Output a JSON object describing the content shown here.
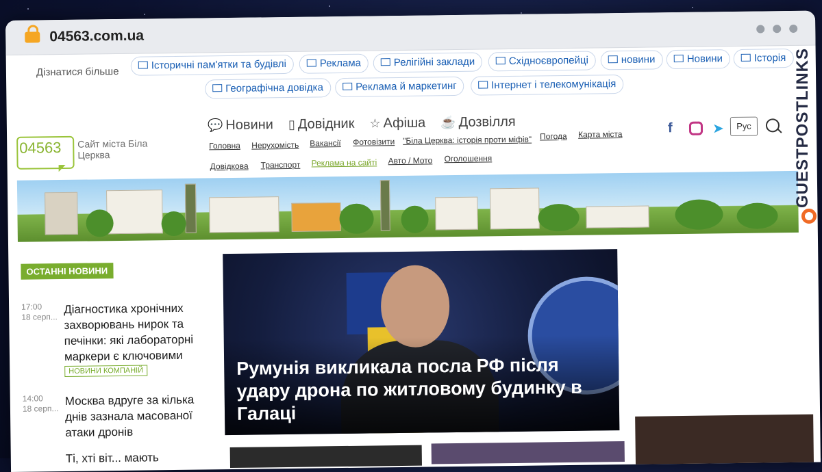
{
  "browser": {
    "url": "04563.com.ua"
  },
  "tags_bar": {
    "label": "Дізнатися більше",
    "tags": [
      "Історичні пам'ятки та будівлі",
      "Реклама",
      "Релігійні заклади",
      "Східноєвропейці",
      "новини",
      "Новини",
      "Історія",
      "Географічна довідка",
      "Реклама й маркетинг",
      "Інтернет і телекомунікація"
    ]
  },
  "site": {
    "logo_number": "04563",
    "logo_caption": "Сайт міста Біла Церква"
  },
  "main_nav": [
    {
      "label": "Новини",
      "icon": "speech-bubble-icon"
    },
    {
      "label": "Довідник",
      "icon": "book-icon"
    },
    {
      "label": "Афіша",
      "icon": "star-icon"
    },
    {
      "label": "Дозвілля",
      "icon": "cup-icon"
    }
  ],
  "sub_nav": {
    "row1": [
      "Головна",
      "Нерухомість",
      "Вакансії",
      "Фотовізити",
      "\"Біла Церква: історія проти міфів\"",
      "Погода",
      "Карта міста"
    ],
    "row2": [
      "Довідкова",
      "Транспорт",
      "Реклама на сайті",
      "Авто / Мото",
      "Оголошення"
    ]
  },
  "header_tools": {
    "language_button": "Рус"
  },
  "watermark": {
    "brand": "GUESTPOSTLINKS"
  },
  "latest_news": {
    "label": "ОСТАННІ НОВИНИ",
    "items": [
      {
        "time": "17:00",
        "date": "18 серп...",
        "headline": "Діагностика хронічних захворювань нирок та печінки: які лабораторні маркери є ключовими",
        "badge": "НОВИНИ КОМПАНІЙ"
      },
      {
        "time": "14:00",
        "date": "18 серп...",
        "headline": "Москва вдруге за кілька днів зазнала масованої атаки дронів",
        "badge": ""
      },
      {
        "time": "",
        "date": "",
        "headline": "Ті, хті віт... мають",
        "badge": ""
      }
    ]
  },
  "featured": {
    "headline": "Румунія викликала посла РФ після удару дрона по житловому будинку в Галаці"
  },
  "colors": {
    "brand_green": "#79ad2e",
    "link_blue": "#1a5fb4",
    "watermark_orange": "#f06a25"
  }
}
